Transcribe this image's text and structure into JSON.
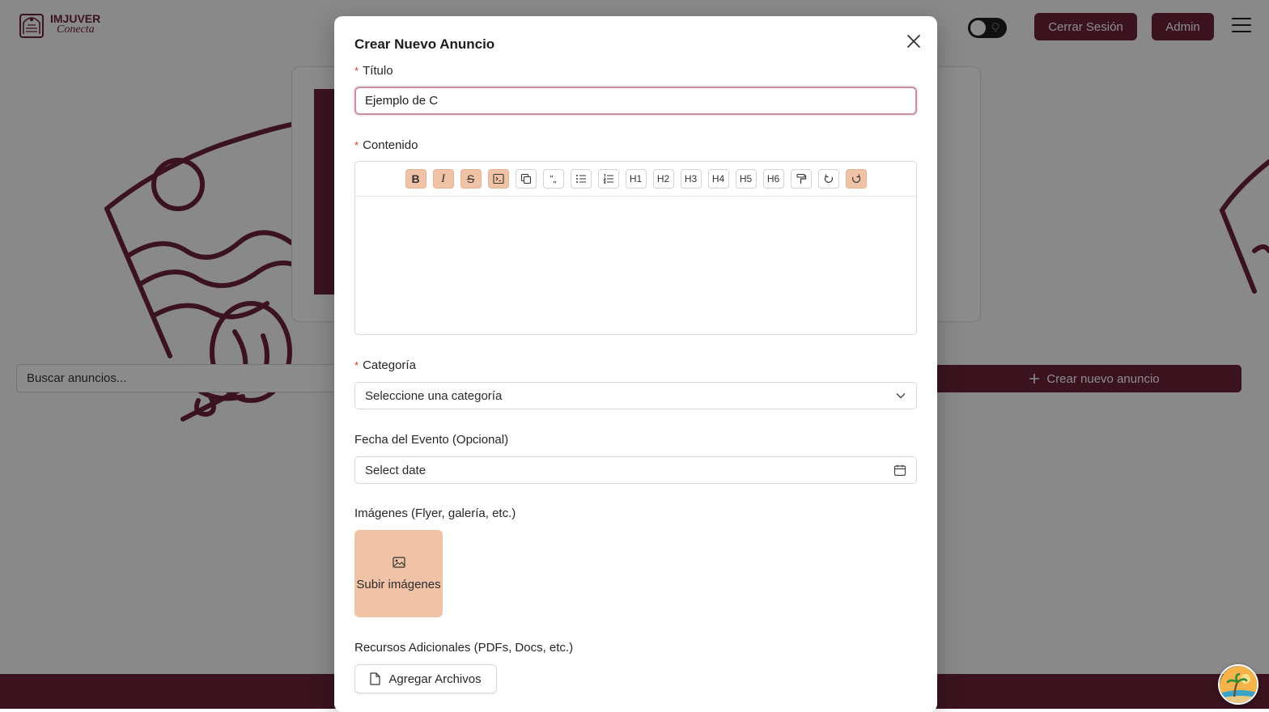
{
  "background": {
    "logo": {
      "title": "IMJUVER",
      "subtitle": "Conecta"
    },
    "header": {
      "logout_label": "Cerrar Sesión",
      "admin_label": "Admin"
    },
    "search": {
      "placeholder": "Buscar anuncios..."
    },
    "create_button_label": "Crear nuevo anuncio"
  },
  "modal": {
    "title": "Crear Nuevo Anuncio",
    "required_mark": "*",
    "fields": {
      "title": {
        "label": "Título",
        "value": "Ejemplo de C"
      },
      "content": {
        "label": "Contenido"
      },
      "category": {
        "label": "Categoría",
        "placeholder": "Seleccione una categoría"
      },
      "event_date": {
        "label": "Fecha del Evento (Opcional)",
        "placeholder": "Select date"
      },
      "images": {
        "label": "Imágenes (Flyer, galería, etc.)",
        "upload_label": "Subir imágenes"
      },
      "resources": {
        "label": "Recursos Adicionales (PDFs, Docs, etc.)",
        "button_label": "Agregar Archivos"
      }
    },
    "toolbar": [
      {
        "name": "bold-button",
        "label": "B",
        "style": "bold",
        "active": true
      },
      {
        "name": "italic-button",
        "label": "I",
        "style": "italic",
        "active": true
      },
      {
        "name": "strikethrough-button",
        "label": "S",
        "style": "strike",
        "active": true
      },
      {
        "name": "code-block-button",
        "icon": "code-block-icon",
        "active": true
      },
      {
        "name": "copy-button",
        "icon": "copy-icon",
        "active": false
      },
      {
        "name": "blockquote-button",
        "label": "“„",
        "active": false
      },
      {
        "name": "bullet-list-button",
        "icon": "bullet-list-icon",
        "active": false
      },
      {
        "name": "ordered-list-button",
        "icon": "ordered-list-icon",
        "active": false
      },
      {
        "name": "heading-1-button",
        "label": "H1",
        "active": false
      },
      {
        "name": "heading-2-button",
        "label": "H2",
        "active": false
      },
      {
        "name": "heading-3-button",
        "label": "H3",
        "active": false
      },
      {
        "name": "heading-4-button",
        "label": "H4",
        "active": false
      },
      {
        "name": "heading-5-button",
        "label": "H5",
        "active": false
      },
      {
        "name": "heading-6-button",
        "label": "H6",
        "active": false
      },
      {
        "name": "clear-format-button",
        "icon": "paint-roller-icon",
        "active": false
      },
      {
        "name": "undo-button",
        "icon": "undo-icon",
        "active": false
      },
      {
        "name": "redo-button",
        "icon": "redo-icon",
        "active": true
      }
    ]
  },
  "colors": {
    "brand": "#6b2338",
    "accent_light": "#f0c3a6",
    "required": "#d9363e"
  }
}
